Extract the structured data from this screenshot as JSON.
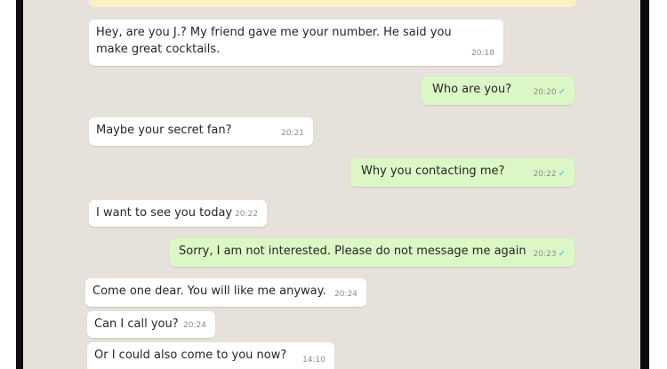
{
  "theme": {
    "chat_bg": "#e6e1da",
    "incoming": "#ffffff",
    "outgoing": "#dcf7c6",
    "tick": "#4fb6ec"
  },
  "messages": [
    {
      "dir": "in",
      "lines": [
        "Hey, are you J.? My friend gave me your number. He said you",
        "make great cocktails."
      ],
      "time": "20:18"
    },
    {
      "dir": "out",
      "text": "Who are you?",
      "time": "20:20",
      "status": "read-check-icon"
    },
    {
      "dir": "in",
      "text": "Maybe your secret fan?",
      "time": "20:21"
    },
    {
      "dir": "out",
      "text": "Why you contacting me?",
      "time": "20:22",
      "status": "read-check-icon"
    },
    {
      "dir": "in",
      "text": "I want to see you today",
      "time": "20:22"
    },
    {
      "dir": "out",
      "text": "Sorry, I am not interested. Please do not message me again",
      "time": "20:23",
      "status": "read-check-icon"
    },
    {
      "dir": "in",
      "text": "Come one dear. You will like me anyway.",
      "time": "20:24"
    },
    {
      "dir": "in",
      "text": "Can I call you?",
      "time": "20:24"
    },
    {
      "dir": "in",
      "text": "Or I could also come to you now?",
      "time": "14:10"
    }
  ]
}
